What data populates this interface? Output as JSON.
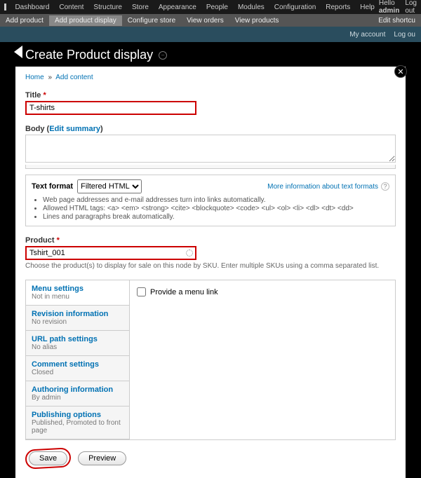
{
  "topbar": {
    "items": [
      "Dashboard",
      "Content",
      "Structure",
      "Store",
      "Appearance",
      "People",
      "Modules",
      "Configuration",
      "Reports",
      "Help"
    ],
    "hello": "Hello",
    "user": "admin",
    "logout": "Log out"
  },
  "shortcut": {
    "items": [
      "Add product",
      "Add product display",
      "Configure store",
      "View orders",
      "View products"
    ],
    "edit": "Edit shortcu"
  },
  "subhead": {
    "myaccount": "My account",
    "logout": "Log ou"
  },
  "page": {
    "title": "Create Product display"
  },
  "breadcrumb": {
    "a": "Home",
    "b": "Add content"
  },
  "title": {
    "label": "Title",
    "value": "T-shirts"
  },
  "body": {
    "label": "Body",
    "edit_summary": "Edit summary",
    "value": ""
  },
  "textformat": {
    "label": "Text format",
    "selected": "Filtered HTML",
    "more": "More information about text formats",
    "hint1": "Web page addresses and e-mail addresses turn into links automatically.",
    "hint2": "Allowed HTML tags: <a> <em> <strong> <cite> <blockquote> <code> <ul> <ol> <li> <dl> <dt> <dd>",
    "hint3": "Lines and paragraphs break automatically."
  },
  "product": {
    "label": "Product",
    "value": "Tshirt_001",
    "desc": "Choose the product(s) to display for sale on this node by SKU. Enter multiple SKUs using a comma separated list."
  },
  "vtabs": {
    "menu": {
      "t": "Menu settings",
      "s": "Not in menu"
    },
    "rev": {
      "t": "Revision information",
      "s": "No revision"
    },
    "url": {
      "t": "URL path settings",
      "s": "No alias"
    },
    "com": {
      "t": "Comment settings",
      "s": "Closed"
    },
    "auth": {
      "t": "Authoring information",
      "s": "By admin"
    },
    "pub": {
      "t": "Publishing options",
      "s": "Published, Promoted to front page"
    },
    "menu_checkbox": "Provide a menu link"
  },
  "actions": {
    "save": "Save",
    "preview": "Preview"
  }
}
